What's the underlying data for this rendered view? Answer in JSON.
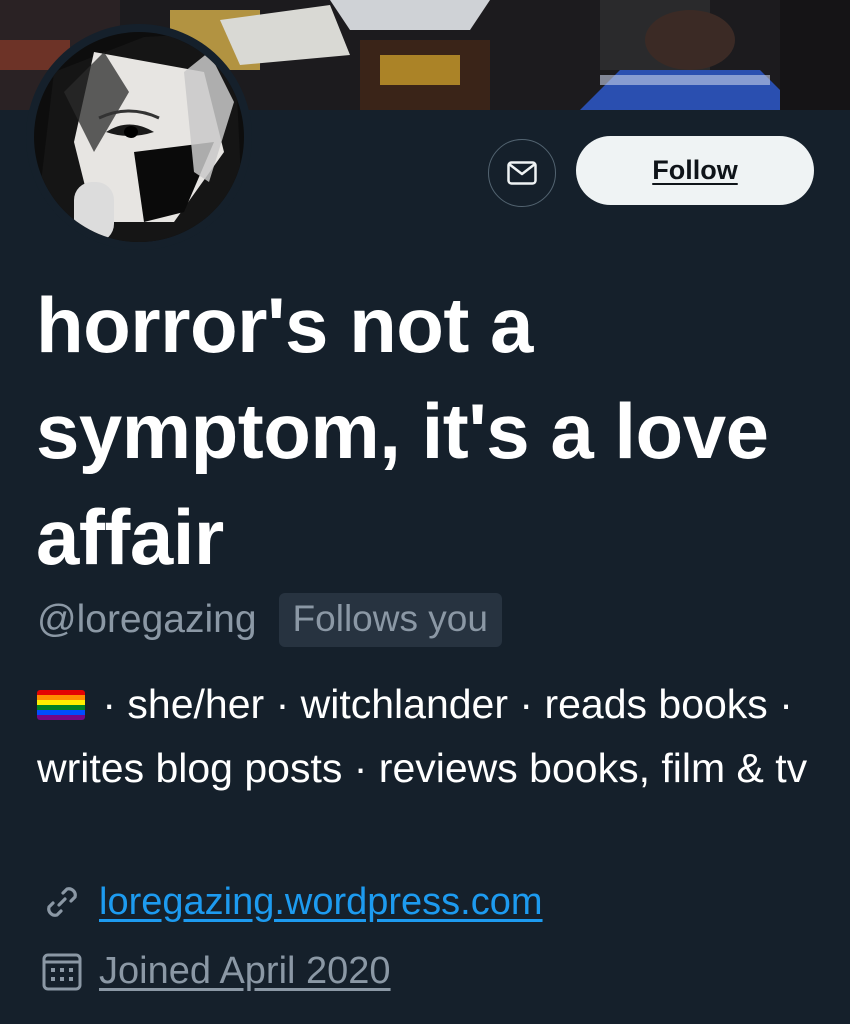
{
  "profile": {
    "display_name": "horror's not a symptom, it's a love affair",
    "handle": "@loregazing",
    "follows_you_badge": "Follows you",
    "bio": {
      "flag_icon": "rainbow-flag-icon",
      "text": " · she/her · witchlander · reads books · writes blog posts · reviews books, film & tv"
    },
    "website": "loregazing.wordpress.com",
    "joined": "Joined April 2020"
  },
  "actions": {
    "message_icon": "envelope-icon",
    "follow_label": "Follow"
  },
  "colors": {
    "background": "#15202b",
    "secondary_text": "#8b98a5",
    "link": "#1d9bf0",
    "follow_button_bg": "#eff3f4",
    "badge_bg": "#273340"
  }
}
